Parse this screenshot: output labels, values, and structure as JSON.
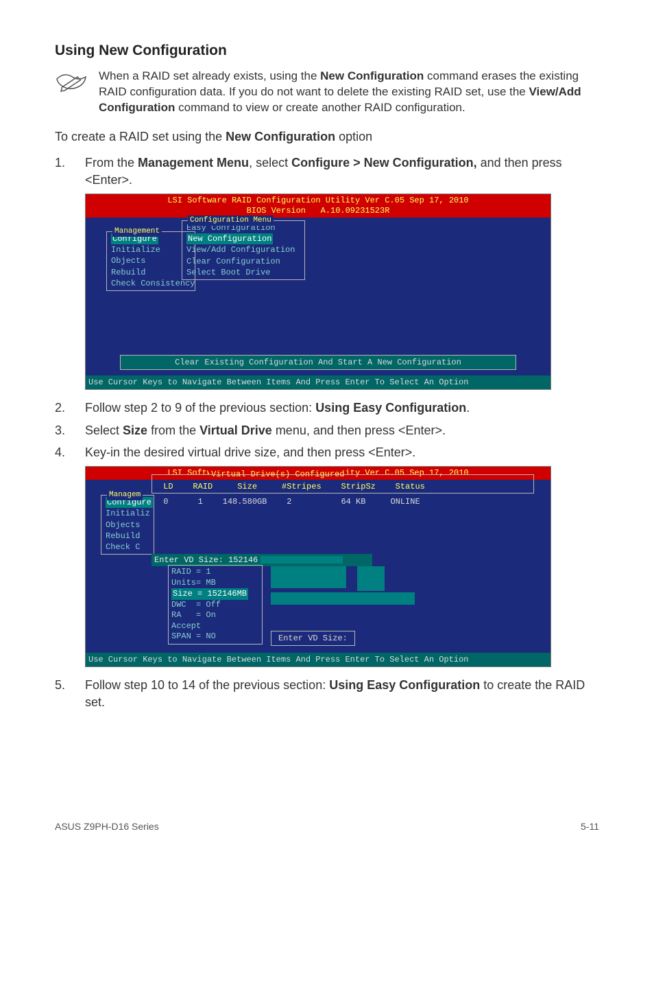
{
  "section_title": "Using New Configuration",
  "note": {
    "parts": [
      "When a RAID set already exists, using the ",
      "New Configuration",
      " command erases the existing RAID configuration data. If you do not want to delete the existing RAID set, use the ",
      "View/Add Configuration",
      " command to view or create another RAID configuration."
    ]
  },
  "intro": {
    "parts": [
      "To create a RAID set using the ",
      "New Configuration",
      " option"
    ]
  },
  "steps": {
    "s1": {
      "num": "1.",
      "parts": [
        "From the ",
        "Management Menu",
        ", select ",
        "Configure > New Configuration,",
        " and then press <Enter>."
      ]
    },
    "s2": {
      "num": "2.",
      "parts": [
        "Follow step 2 to 9 of the previous section: ",
        "Using Easy Configuration",
        "."
      ]
    },
    "s3": {
      "num": "3.",
      "parts": [
        "Select ",
        "Size",
        " from the ",
        "Virtual Drive",
        " menu, and then press <Enter>."
      ]
    },
    "s4": {
      "num": "4.",
      "text": "Key-in the desired virtual drive size, and then press <Enter>."
    },
    "s5": {
      "num": "5.",
      "parts": [
        "Follow step 10 to 14 of the previous section: ",
        "Using Easy Configuration",
        " to create the RAID set."
      ]
    }
  },
  "bios1": {
    "title_l1": "LSI Software RAID Configuration Utility Ver C.05 Sep 17, 2010",
    "title_l2": "BIOS Version   A.10.09231523R",
    "mgmt_legend": "Management",
    "mgmt_items": [
      "Configure",
      "Initialize",
      "Objects",
      "Rebuild",
      "Check Consistency"
    ],
    "cfg_legend": "Configuration Menu",
    "cfg_items": [
      "Easy Configuration",
      "New Configuration",
      "View/Add Configuration",
      "Clear Configuration",
      "Select Boot Drive"
    ],
    "hint": "Clear Existing Configuration And Start A New Configuration",
    "status": "Use Cursor Keys to Navigate Between Items And Press Enter To Select An Option"
  },
  "bios2": {
    "title_l1": "LSI Software RAID Configuration Utility Ver C.05 Sep 17, 2010",
    "vd_legend": "Virtual Drive(s) Configured",
    "headers": " LD    RAID     Size     #Stripes    StripSz    Status",
    "row0": " 0      1    148.580GB    2          64 KB     ONLINE",
    "mgmt_legend": "Managem",
    "mgmt_items": [
      "Configure",
      "Initializ",
      "Objects",
      "Rebuild",
      "Check C"
    ],
    "enter_size_label": "Enter VD Size: 152146",
    "props": [
      "RAID = 1",
      "Units= MB",
      "Size = 152146MB",
      "DWC  = Off",
      "RA   = On",
      "Accept",
      "SPAN = NO"
    ],
    "hint": "Enter VD Size:",
    "status": "Use Cursor Keys to Navigate Between Items And Press Enter To Select An Option"
  },
  "footer": {
    "left": "ASUS Z9PH-D16 Series",
    "right": "5-11"
  }
}
